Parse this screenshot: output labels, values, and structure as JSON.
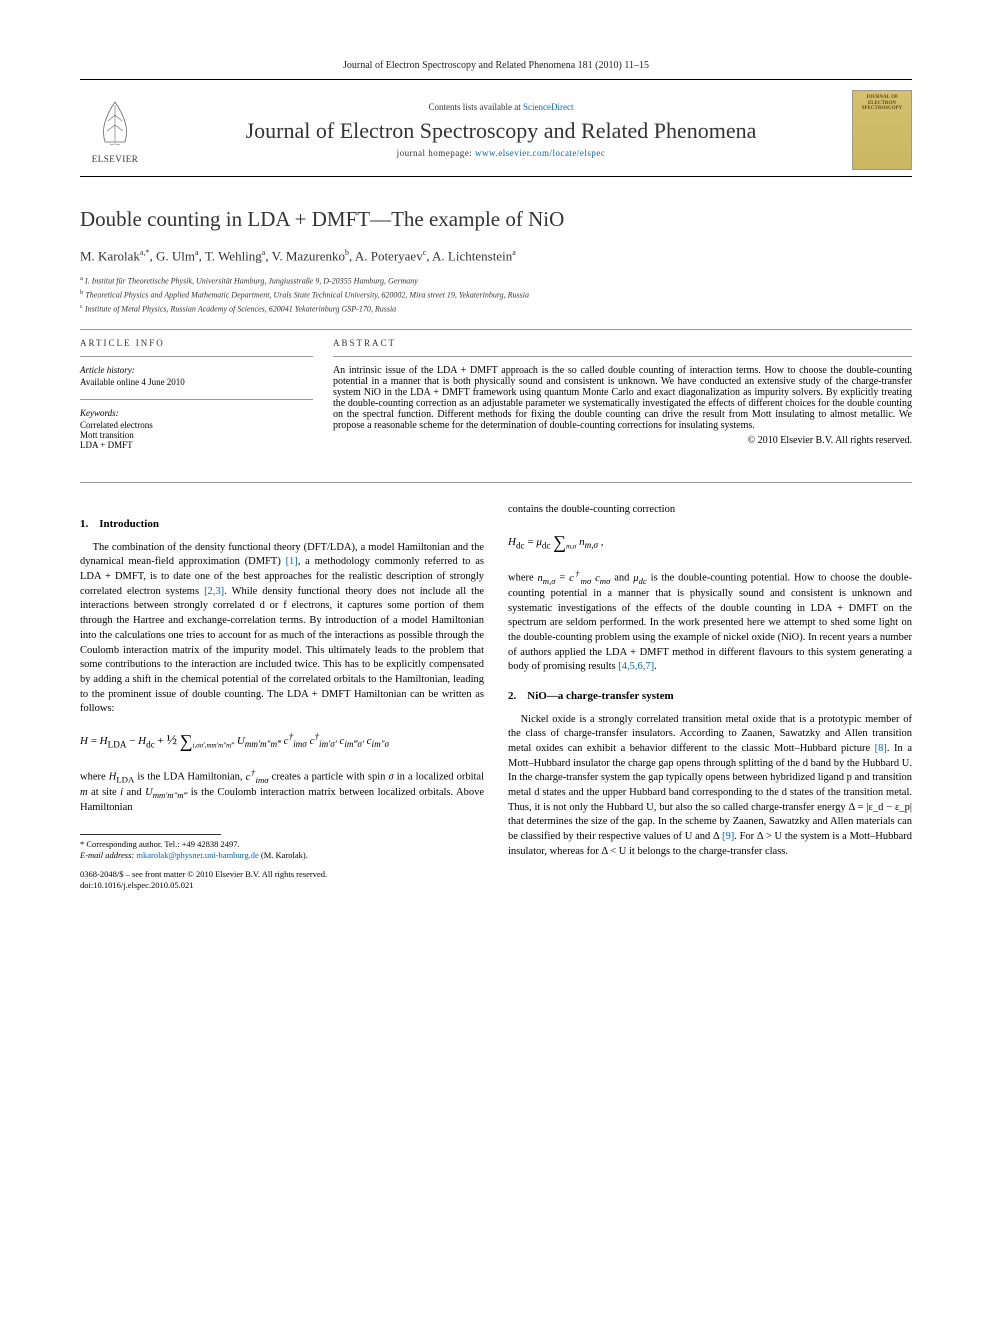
{
  "journal_ref": "Journal of Electron Spectroscopy and Related Phenomena 181 (2010) 11–15",
  "header": {
    "contents_prefix": "Contents lists available at ",
    "contents_link": "ScienceDirect",
    "journal_title": "Journal of Electron Spectroscopy and Related Phenomena",
    "homepage_prefix": "journal homepage: ",
    "homepage_url": "www.elsevier.com/locate/elspec",
    "publisher_name": "ELSEVIER"
  },
  "title": "Double counting in LDA + DMFT—The example of NiO",
  "authors_html": "M. Karolak<sup>a,*</sup>, G. Ulm<sup>a</sup>, T. Wehling<sup>a</sup>, V. Mazurenko<sup>b</sup>, A. Poteryaev<sup>c</sup>, A. Lichtenstein<sup>a</sup>",
  "affiliations": [
    "a I. Institut für Theoretische Physik, Universität Hamburg, Jungiusstraße 9, D-20355 Hamburg, Germany",
    "b Theoretical Physics and Applied Mathematic Department, Urals State Technical University, 620002, Mira street 19, Yekaterinburg, Russia",
    "c Institute of Metal Physics, Russian Academy of Sciences, 620041 Yekaterinburg GSP-170, Russia"
  ],
  "info": {
    "label": "article info",
    "history_label": "Article history:",
    "history": "Available online 4 June 2010",
    "keywords_label": "Keywords:",
    "keywords": [
      "Correlated electrons",
      "Mott transition",
      "LDA + DMFT"
    ]
  },
  "abstract": {
    "label": "abstract",
    "text": "An intrinsic issue of the LDA + DMFT approach is the so called double counting of interaction terms. How to choose the double-counting potential in a manner that is both physically sound and consistent is unknown. We have conducted an extensive study of the charge-transfer system NiO in the LDA + DMFT framework using quantum Monte Carlo and exact diagonalization as impurity solvers. By explicitly treating the double-counting correction as an adjustable parameter we systematically investigated the effects of different choices for the double counting on the spectral function. Different methods for fixing the double counting can drive the result from Mott insulating to almost metallic. We propose a reasonable scheme for the determination of double-counting corrections for insulating systems.",
    "copyright": "© 2010 Elsevier B.V. All rights reserved."
  },
  "sections": {
    "intro_heading": "1. Introduction",
    "intro_p1a": "The combination of the density functional theory (DFT/LDA), a model Hamiltonian and the dynamical mean-field approximation (DMFT) ",
    "intro_ref1": "[1]",
    "intro_p1b": ", a methodology commonly referred to as LDA + DMFT, is to date one of the best approaches for the realistic description of strongly correlated electron systems ",
    "intro_ref2": "[2,3]",
    "intro_p1c": ". While density functional theory does not include all the interactions between strongly correlated d or f electrons, it captures some portion of them through the Hartree and exchange-correlation terms. By introduction of a model Hamiltonian into the calculations one tries to account for as much of the interactions as possible through the Coulomb interaction matrix of the impurity model. This ultimately leads to the problem that some contributions to the interaction are included twice. This has to be explicitly compensated by adding a shift in the chemical potential of the correlated orbitals to the Hamiltonian, leading to the prominent issue of double counting. The LDA + DMFT Hamiltonian can be written as follows:",
    "eq1": "H = H_LDA − H_dc + ½ ∑_{i,σσ′,mm′m″m‴} U_{mm′m″m‴} c†_{imσ} c†_{im′σ′} c_{im‴σ′} c_{im″σ}",
    "intro_p2": "where H_LDA is the LDA Hamiltonian, c†_{imσ} creates a particle with spin σ in a localized orbital m at site i and U_{mm′m″m‴} is the Coulomb interaction matrix between localized orbitals. Above Hamiltonian",
    "col2_p1": "contains the double-counting correction",
    "eq2": "H_dc = μ_dc ∑_{m,σ} n_{m,σ} ,",
    "col2_p2a": "where n_{m,σ} = c†_{mσ} c_{mσ} and μ_dc is the double-counting potential. How to choose the double-counting potential in a manner that is physically sound and consistent is unknown and systematic investigations of the effects of the double counting in LDA + DMFT on the spectrum are seldom performed. In the work presented here we attempt to shed some light on the double-counting problem using the example of nickel oxide (NiO). In recent years a number of authors applied the LDA + DMFT method in different flavours to this system generating a body of promising results ",
    "col2_ref3": "[4,5,6,7]",
    "col2_p2b": ".",
    "nio_heading": "2. NiO—a charge-transfer system",
    "nio_p1a": "Nickel oxide is a strongly correlated transition metal oxide that is a prototypic member of the class of charge-transfer insulators. According to Zaanen, Sawatzky and Allen transition metal oxides can exhibit a behavior different to the classic Mott–Hubbard picture ",
    "nio_ref1": "[8]",
    "nio_p1b": ". In a Mott–Hubbard insulator the charge gap opens through splitting of the d band by the Hubbard U. In the charge-transfer system the gap typically opens between hybridized ligand p and transition metal d states and the upper Hubbard band corresponding to the d states of the transition metal. Thus, it is not only the Hubbard U, but also the so called charge-transfer energy Δ = |ε_d − ε_p| that determines the size of the gap. In the scheme by Zaanen, Sawatzky and Allen materials can be classified by their respective values of U and Δ ",
    "nio_ref2": "[9]",
    "nio_p1c": ". For Δ > U the system is a Mott–Hubbard insulator, whereas for Δ < U it belongs to the charge-transfer class."
  },
  "footnote": {
    "corr": "* Corresponding author. Tel.: +49 42838 2497.",
    "email_label": "E-mail address: ",
    "email": "mkarolak@physnet.uni-hamburg.de",
    "email_suffix": " (M. Karolak)."
  },
  "doi": {
    "line1": "0368-2048/$ – see front matter © 2010 Elsevier B.V. All rights reserved.",
    "line2": "doi:10.1016/j.elspec.2010.05.021"
  }
}
